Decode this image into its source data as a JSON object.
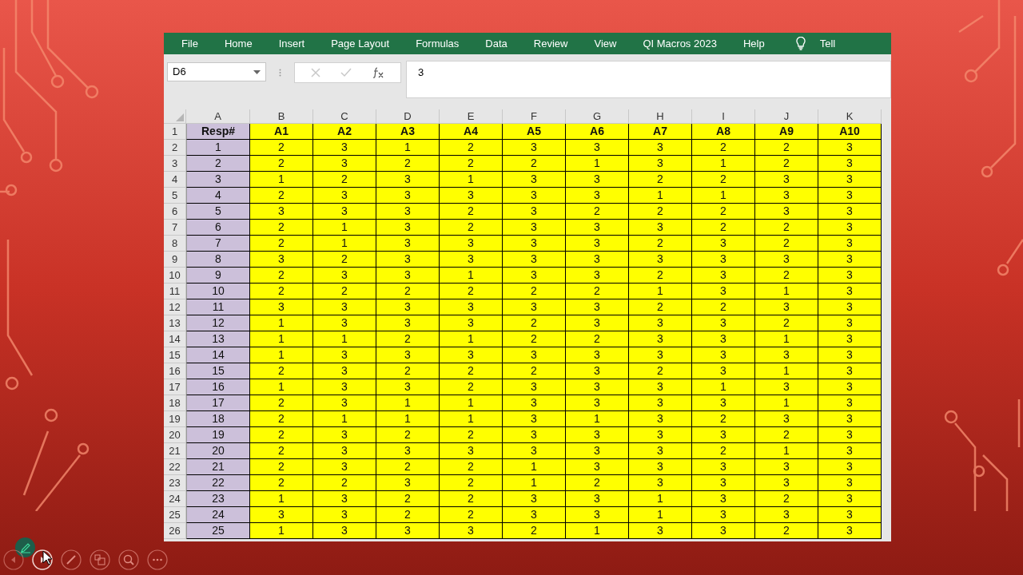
{
  "ribbon": {
    "tabs": [
      {
        "label": "File"
      },
      {
        "label": "Home"
      },
      {
        "label": "Insert"
      },
      {
        "label": "Page Layout"
      },
      {
        "label": "Formulas"
      },
      {
        "label": "Data"
      },
      {
        "label": "Review"
      },
      {
        "label": "View"
      },
      {
        "label": "QI Macros 2023"
      },
      {
        "label": "Help"
      }
    ],
    "tell_me": "Tell"
  },
  "formula_bar": {
    "name_box": "D6",
    "value": "3"
  },
  "sheet": {
    "column_headers": [
      "A",
      "B",
      "C",
      "D",
      "E",
      "F",
      "G",
      "H",
      "I",
      "J",
      "K"
    ],
    "row_numbers": [
      "1",
      "2",
      "3",
      "4",
      "5",
      "6",
      "7",
      "8",
      "9",
      "10",
      "11",
      "12",
      "13",
      "14",
      "15",
      "16",
      "17",
      "18",
      "19",
      "20",
      "21",
      "22",
      "23",
      "24",
      "25",
      "26"
    ],
    "header_row": [
      "Resp#",
      "A1",
      "A2",
      "A3",
      "A4",
      "A5",
      "A6",
      "A7",
      "A8",
      "A9",
      "A10"
    ],
    "rows": [
      [
        "1",
        "2",
        "3",
        "1",
        "2",
        "3",
        "3",
        "3",
        "2",
        "2",
        "3"
      ],
      [
        "2",
        "2",
        "3",
        "2",
        "2",
        "2",
        "1",
        "3",
        "1",
        "2",
        "3"
      ],
      [
        "3",
        "1",
        "2",
        "3",
        "1",
        "3",
        "3",
        "2",
        "2",
        "3",
        "3"
      ],
      [
        "4",
        "2",
        "3",
        "3",
        "3",
        "3",
        "3",
        "1",
        "1",
        "3",
        "3"
      ],
      [
        "5",
        "3",
        "3",
        "3",
        "2",
        "3",
        "2",
        "2",
        "2",
        "3",
        "3"
      ],
      [
        "6",
        "2",
        "1",
        "3",
        "2",
        "3",
        "3",
        "3",
        "2",
        "2",
        "3"
      ],
      [
        "7",
        "2",
        "1",
        "3",
        "3",
        "3",
        "3",
        "2",
        "3",
        "2",
        "3"
      ],
      [
        "8",
        "3",
        "2",
        "3",
        "3",
        "3",
        "3",
        "3",
        "3",
        "3",
        "3"
      ],
      [
        "9",
        "2",
        "3",
        "3",
        "1",
        "3",
        "3",
        "2",
        "3",
        "2",
        "3"
      ],
      [
        "10",
        "2",
        "2",
        "2",
        "2",
        "2",
        "2",
        "1",
        "3",
        "1",
        "3"
      ],
      [
        "11",
        "3",
        "3",
        "3",
        "3",
        "3",
        "3",
        "2",
        "2",
        "3",
        "3"
      ],
      [
        "12",
        "1",
        "3",
        "3",
        "3",
        "2",
        "3",
        "3",
        "3",
        "2",
        "3"
      ],
      [
        "13",
        "1",
        "1",
        "2",
        "1",
        "2",
        "2",
        "3",
        "3",
        "1",
        "3"
      ],
      [
        "14",
        "1",
        "3",
        "3",
        "3",
        "3",
        "3",
        "3",
        "3",
        "3",
        "3"
      ],
      [
        "15",
        "2",
        "3",
        "2",
        "2",
        "2",
        "3",
        "2",
        "3",
        "1",
        "3"
      ],
      [
        "16",
        "1",
        "3",
        "3",
        "2",
        "3",
        "3",
        "3",
        "1",
        "3",
        "3"
      ],
      [
        "17",
        "2",
        "3",
        "1",
        "1",
        "3",
        "3",
        "3",
        "3",
        "1",
        "3"
      ],
      [
        "18",
        "2",
        "1",
        "1",
        "1",
        "3",
        "1",
        "3",
        "2",
        "3",
        "3"
      ],
      [
        "19",
        "2",
        "3",
        "2",
        "2",
        "3",
        "3",
        "3",
        "3",
        "2",
        "3"
      ],
      [
        "20",
        "2",
        "3",
        "3",
        "3",
        "3",
        "3",
        "3",
        "2",
        "1",
        "3"
      ],
      [
        "21",
        "2",
        "3",
        "2",
        "2",
        "1",
        "3",
        "3",
        "3",
        "3",
        "3"
      ],
      [
        "22",
        "2",
        "2",
        "3",
        "2",
        "1",
        "2",
        "3",
        "3",
        "3",
        "3"
      ],
      [
        "23",
        "1",
        "3",
        "2",
        "2",
        "3",
        "3",
        "1",
        "3",
        "2",
        "3"
      ],
      [
        "24",
        "3",
        "3",
        "2",
        "2",
        "3",
        "3",
        "1",
        "3",
        "3",
        "3"
      ],
      [
        "25",
        "1",
        "3",
        "3",
        "3",
        "2",
        "1",
        "3",
        "3",
        "2",
        "3"
      ]
    ]
  }
}
